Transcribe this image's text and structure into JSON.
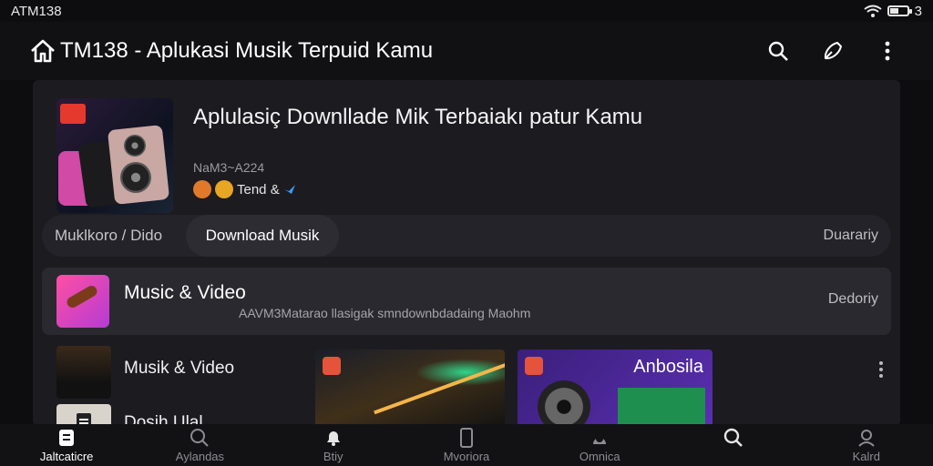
{
  "status_bar": {
    "carrier": "ATM138",
    "time": "3"
  },
  "app_bar": {
    "title": "TM138 - Aplukasi Musik Terpuid Kamu"
  },
  "featured": {
    "title": "Aplulasiç Downllade Mik Terbaiakı patur Kamu",
    "subtitle": "NaM3~A224",
    "meta": "Tend &",
    "image_label": "featured-album-art"
  },
  "tabs": [
    {
      "label": "Muklkoro / Dido"
    },
    {
      "label": "Download Musik"
    },
    {
      "label": "Duarariy"
    }
  ],
  "category_row": {
    "title": "Music & Video",
    "subtitle": "AAVM3Matarao llasigak smndownbdadaing Maohm",
    "action": "Dedoriy"
  },
  "list": [
    {
      "title": "Musik & Video"
    },
    {
      "title": "Dosih Ulal"
    }
  ],
  "cards": [
    {
      "label": ""
    },
    {
      "label": "Anbosila"
    }
  ],
  "bottom_nav": [
    {
      "label": "Jaltcaticre",
      "icon": "home-icon",
      "active": true
    },
    {
      "label": "Aylandas",
      "icon": "search-icon"
    },
    {
      "label": "Btiy",
      "icon": "bell-icon"
    },
    {
      "label": "Mvoriora",
      "icon": "phone-icon"
    },
    {
      "label": "Omnica",
      "icon": "music-icon"
    },
    {
      "label": "",
      "icon": "search-icon"
    },
    {
      "label": "Kalrd",
      "icon": "user-icon"
    }
  ],
  "colors": {
    "accent": "#e5392d",
    "background": "#0d0d0f",
    "surface": "#1c1b20"
  }
}
